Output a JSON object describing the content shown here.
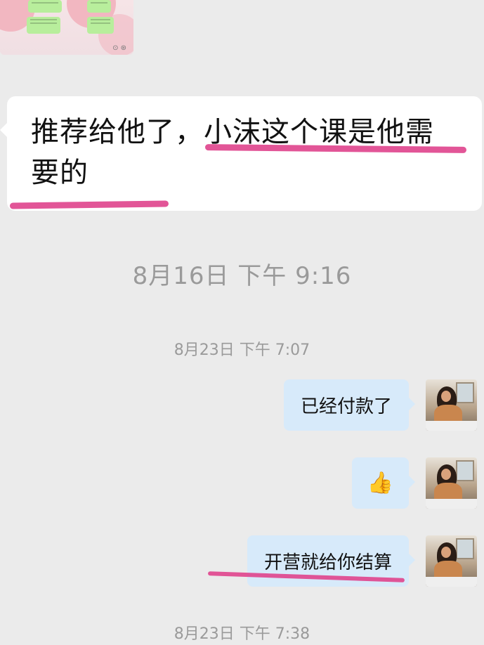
{
  "top_thumbnail": {
    "description_icons": "⊙ ⊛"
  },
  "message_in": {
    "line1_text": "推荐给他了，小沫这个课是他需",
    "line2_text": "要的"
  },
  "timestamps": [
    "8月16日  下午 9:16",
    "8月23日  下午 7:07",
    "8月23日  下午 7:38"
  ],
  "messages_out": [
    {
      "text": "已经付款了"
    },
    {
      "text": "👍"
    },
    {
      "text": "开营就给你结算"
    }
  ],
  "colors": {
    "background": "#ebebeb",
    "incoming_bubble": "#ffffff",
    "outgoing_bubble": "#d7eafa",
    "highlight_mark": "#e0478e",
    "timestamp_text": "#9a9a9a"
  }
}
